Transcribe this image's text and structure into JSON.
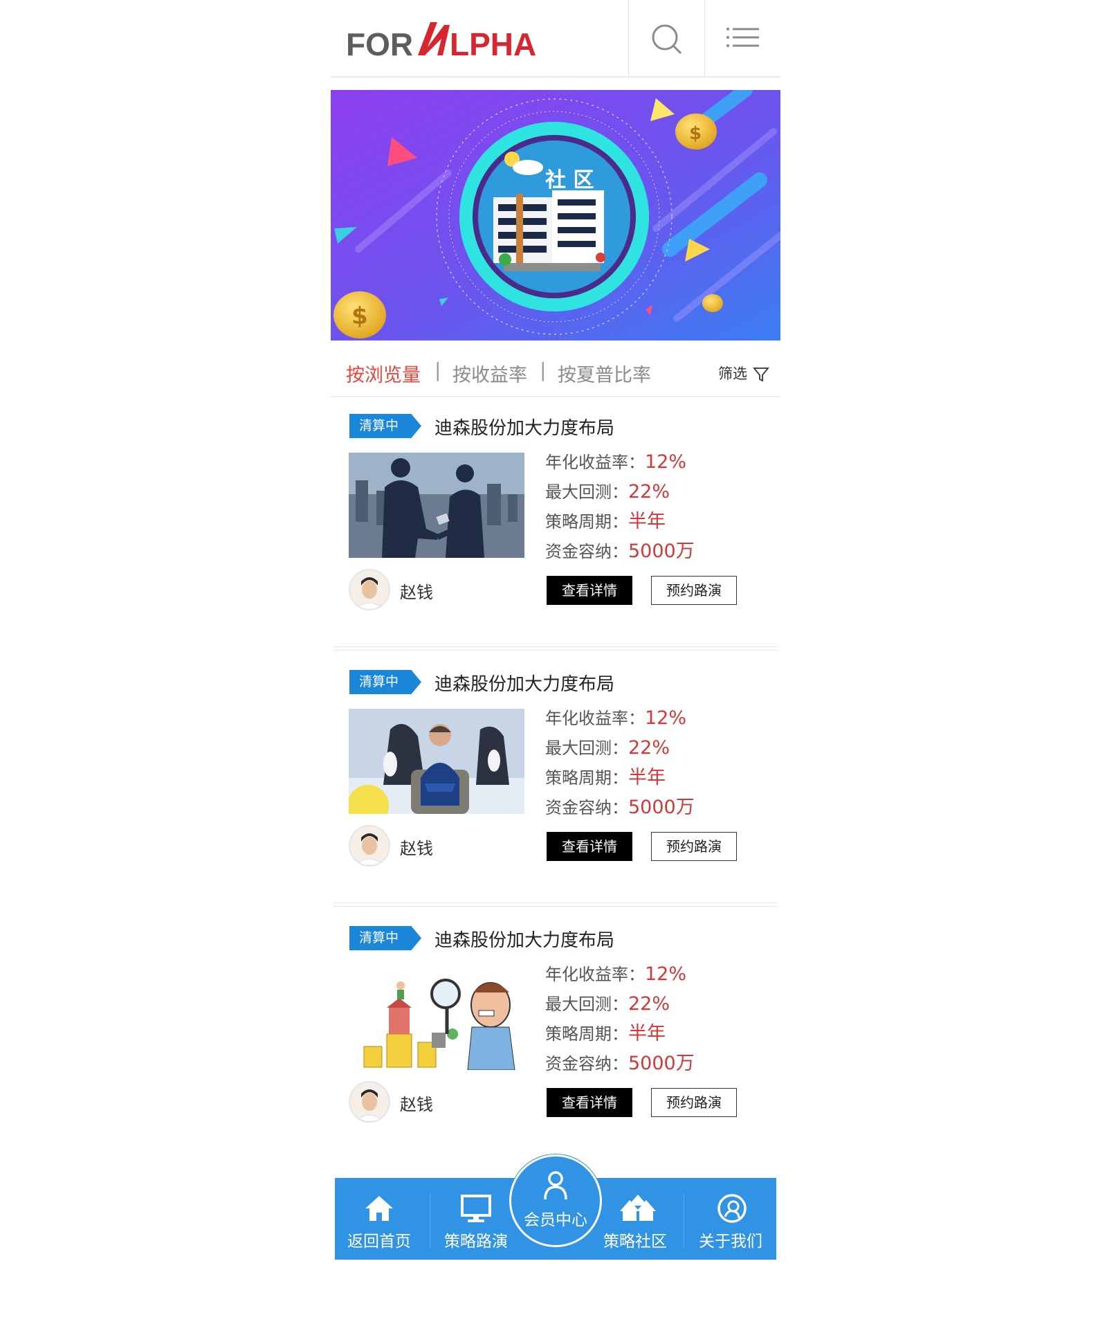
{
  "header": {
    "logo_for": "FOR",
    "logo_alpha": "LPHA"
  },
  "banner": {
    "caption": "社 区"
  },
  "sort": {
    "items": [
      "按浏览量",
      "按收益率",
      "按夏普比率"
    ],
    "separator": "|",
    "active_index": 0,
    "filter_label": "筛选"
  },
  "cards": [
    {
      "badge": "清算中",
      "title": "迪森股份加大力度布局",
      "stats": [
        {
          "label": "年化收益率：",
          "value": "12%"
        },
        {
          "label": "最大回测：",
          "value": "22%"
        },
        {
          "label": "策略周期：",
          "value": "半年"
        },
        {
          "label": "资金容纳：",
          "value": "5000万"
        }
      ],
      "author": "赵钱",
      "detail_button": "查看详情",
      "roadshow_button": "预约路演"
    },
    {
      "badge": "清算中",
      "title": "迪森股份加大力度布局",
      "stats": [
        {
          "label": "年化收益率：",
          "value": "12%"
        },
        {
          "label": "最大回测：",
          "value": "22%"
        },
        {
          "label": "策略周期：",
          "value": "半年"
        },
        {
          "label": "资金容纳：",
          "value": "5000万"
        }
      ],
      "author": "赵钱",
      "detail_button": "查看详情",
      "roadshow_button": "预约路演"
    },
    {
      "badge": "清算中",
      "title": "迪森股份加大力度布局",
      "stats": [
        {
          "label": "年化收益率：",
          "value": "12%"
        },
        {
          "label": "最大回测：",
          "value": "22%"
        },
        {
          "label": "策略周期：",
          "value": "半年"
        },
        {
          "label": "资金容纳：",
          "value": "5000万"
        }
      ],
      "author": "赵钱",
      "detail_button": "查看详情",
      "roadshow_button": "预约路演"
    }
  ],
  "bottom_nav": {
    "items": [
      {
        "label": "返回首页",
        "icon": "home-icon"
      },
      {
        "label": "策略路演",
        "icon": "monitor-icon"
      },
      {
        "label": "会员中心",
        "icon": "user-icon"
      },
      {
        "label": "策略社区",
        "icon": "houses-icon"
      },
      {
        "label": "关于我们",
        "icon": "about-icon"
      }
    ]
  },
  "colors": {
    "accent_blue": "#3193e3",
    "badge_blue": "#1a87d9",
    "value_red": "#d23838",
    "active_sort_red": "#e2463c",
    "logo_red": "#d7262f",
    "logo_gray": "#5d5d5d"
  }
}
